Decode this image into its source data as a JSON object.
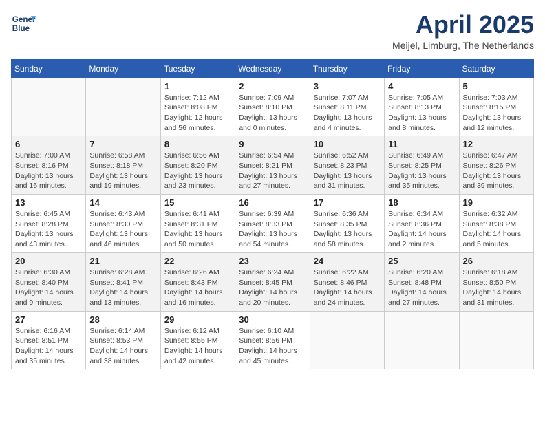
{
  "logo": {
    "line1": "General",
    "line2": "Blue"
  },
  "title": "April 2025",
  "location": "Meijel, Limburg, The Netherlands",
  "weekdays": [
    "Sunday",
    "Monday",
    "Tuesday",
    "Wednesday",
    "Thursday",
    "Friday",
    "Saturday"
  ],
  "weeks": [
    [
      {
        "day": "",
        "info": ""
      },
      {
        "day": "",
        "info": ""
      },
      {
        "day": "1",
        "info": "Sunrise: 7:12 AM\nSunset: 8:08 PM\nDaylight: 12 hours\nand 56 minutes."
      },
      {
        "day": "2",
        "info": "Sunrise: 7:09 AM\nSunset: 8:10 PM\nDaylight: 13 hours\nand 0 minutes."
      },
      {
        "day": "3",
        "info": "Sunrise: 7:07 AM\nSunset: 8:11 PM\nDaylight: 13 hours\nand 4 minutes."
      },
      {
        "day": "4",
        "info": "Sunrise: 7:05 AM\nSunset: 8:13 PM\nDaylight: 13 hours\nand 8 minutes."
      },
      {
        "day": "5",
        "info": "Sunrise: 7:03 AM\nSunset: 8:15 PM\nDaylight: 13 hours\nand 12 minutes."
      }
    ],
    [
      {
        "day": "6",
        "info": "Sunrise: 7:00 AM\nSunset: 8:16 PM\nDaylight: 13 hours\nand 16 minutes."
      },
      {
        "day": "7",
        "info": "Sunrise: 6:58 AM\nSunset: 8:18 PM\nDaylight: 13 hours\nand 19 minutes."
      },
      {
        "day": "8",
        "info": "Sunrise: 6:56 AM\nSunset: 8:20 PM\nDaylight: 13 hours\nand 23 minutes."
      },
      {
        "day": "9",
        "info": "Sunrise: 6:54 AM\nSunset: 8:21 PM\nDaylight: 13 hours\nand 27 minutes."
      },
      {
        "day": "10",
        "info": "Sunrise: 6:52 AM\nSunset: 8:23 PM\nDaylight: 13 hours\nand 31 minutes."
      },
      {
        "day": "11",
        "info": "Sunrise: 6:49 AM\nSunset: 8:25 PM\nDaylight: 13 hours\nand 35 minutes."
      },
      {
        "day": "12",
        "info": "Sunrise: 6:47 AM\nSunset: 8:26 PM\nDaylight: 13 hours\nand 39 minutes."
      }
    ],
    [
      {
        "day": "13",
        "info": "Sunrise: 6:45 AM\nSunset: 8:28 PM\nDaylight: 13 hours\nand 43 minutes."
      },
      {
        "day": "14",
        "info": "Sunrise: 6:43 AM\nSunset: 8:30 PM\nDaylight: 13 hours\nand 46 minutes."
      },
      {
        "day": "15",
        "info": "Sunrise: 6:41 AM\nSunset: 8:31 PM\nDaylight: 13 hours\nand 50 minutes."
      },
      {
        "day": "16",
        "info": "Sunrise: 6:39 AM\nSunset: 8:33 PM\nDaylight: 13 hours\nand 54 minutes."
      },
      {
        "day": "17",
        "info": "Sunrise: 6:36 AM\nSunset: 8:35 PM\nDaylight: 13 hours\nand 58 minutes."
      },
      {
        "day": "18",
        "info": "Sunrise: 6:34 AM\nSunset: 8:36 PM\nDaylight: 14 hours\nand 2 minutes."
      },
      {
        "day": "19",
        "info": "Sunrise: 6:32 AM\nSunset: 8:38 PM\nDaylight: 14 hours\nand 5 minutes."
      }
    ],
    [
      {
        "day": "20",
        "info": "Sunrise: 6:30 AM\nSunset: 8:40 PM\nDaylight: 14 hours\nand 9 minutes."
      },
      {
        "day": "21",
        "info": "Sunrise: 6:28 AM\nSunset: 8:41 PM\nDaylight: 14 hours\nand 13 minutes."
      },
      {
        "day": "22",
        "info": "Sunrise: 6:26 AM\nSunset: 8:43 PM\nDaylight: 14 hours\nand 16 minutes."
      },
      {
        "day": "23",
        "info": "Sunrise: 6:24 AM\nSunset: 8:45 PM\nDaylight: 14 hours\nand 20 minutes."
      },
      {
        "day": "24",
        "info": "Sunrise: 6:22 AM\nSunset: 8:46 PM\nDaylight: 14 hours\nand 24 minutes."
      },
      {
        "day": "25",
        "info": "Sunrise: 6:20 AM\nSunset: 8:48 PM\nDaylight: 14 hours\nand 27 minutes."
      },
      {
        "day": "26",
        "info": "Sunrise: 6:18 AM\nSunset: 8:50 PM\nDaylight: 14 hours\nand 31 minutes."
      }
    ],
    [
      {
        "day": "27",
        "info": "Sunrise: 6:16 AM\nSunset: 8:51 PM\nDaylight: 14 hours\nand 35 minutes."
      },
      {
        "day": "28",
        "info": "Sunrise: 6:14 AM\nSunset: 8:53 PM\nDaylight: 14 hours\nand 38 minutes."
      },
      {
        "day": "29",
        "info": "Sunrise: 6:12 AM\nSunset: 8:55 PM\nDaylight: 14 hours\nand 42 minutes."
      },
      {
        "day": "30",
        "info": "Sunrise: 6:10 AM\nSunset: 8:56 PM\nDaylight: 14 hours\nand 45 minutes."
      },
      {
        "day": "",
        "info": ""
      },
      {
        "day": "",
        "info": ""
      },
      {
        "day": "",
        "info": ""
      }
    ]
  ]
}
